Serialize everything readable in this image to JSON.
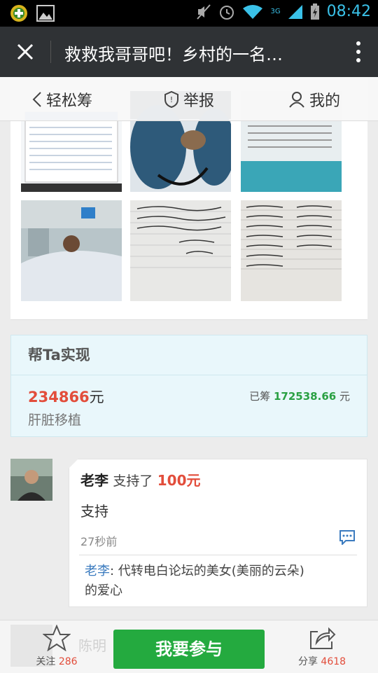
{
  "status_bar": {
    "time": "08:42",
    "network": "3G"
  },
  "title_bar": {
    "title": "救救我哥哥吧！乡村的一名…"
  },
  "top_nav": {
    "back_label": "轻松筹",
    "report_label": "举报",
    "mine_label": "我的"
  },
  "goal_card": {
    "header": "帮Ta实现",
    "target_amount": "234866",
    "target_unit": "元",
    "raised_prefix": "已筹",
    "raised_amount": "172538.66",
    "raised_unit": "元",
    "purpose": "肝脏移植"
  },
  "comment": {
    "name": "老李",
    "verb": "支持了",
    "amount": "100元",
    "message": "支持",
    "time": "27秒前",
    "reply_name": "老李",
    "reply_text": ": 代转电白论坛的美女(美丽的云朵)的爱心"
  },
  "bottom_bar": {
    "follow_label": "关注",
    "follow_count": "286",
    "join_label": "我要参与",
    "share_label": "分享",
    "share_count": "4618",
    "ghost_name": "陈明"
  },
  "colors": {
    "accent_green": "#24aa3f",
    "amount_red": "#e24d3b",
    "titlebar": "#2f3235",
    "goal_bg": "#e9f7fb"
  }
}
